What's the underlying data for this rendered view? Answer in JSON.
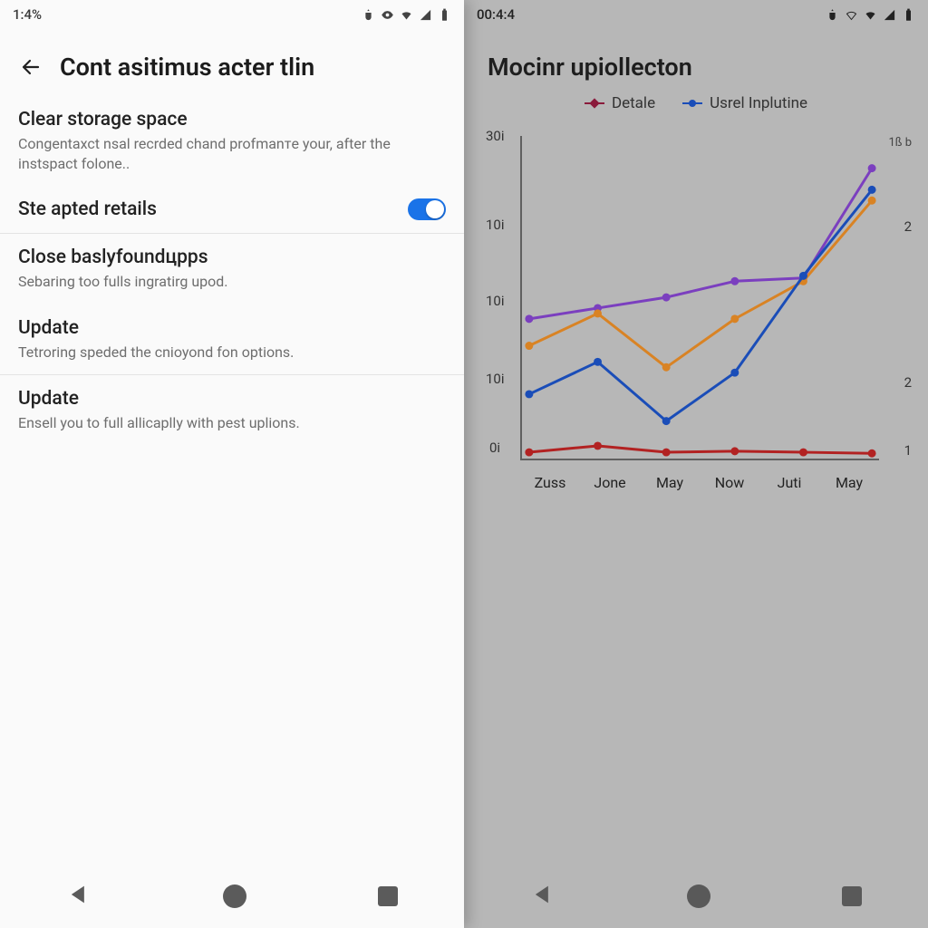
{
  "left": {
    "status_time": "1:4%",
    "title": "Cont asitimus acter tlin",
    "items": [
      {
        "title": "Clear storage space",
        "sub": "Congentaxct nsal recrded chand profmanтe your, after the instspact folone.."
      },
      {
        "title": "Ste apted retails",
        "toggle": true
      },
      {
        "title": "Close baslyfoundцpps",
        "sub": "Sebaring too fulls ingratirg upod."
      },
      {
        "title": "Update",
        "sub": "Tetroring speded the cnioyond fon options."
      },
      {
        "title": "Update",
        "sub": "Ensell you to full allicaplly with pest uplions."
      }
    ]
  },
  "right": {
    "status_time": "00:4:4",
    "title": "Mocinr upiollecton",
    "legend": [
      {
        "name": "Detale",
        "color": "#8a1a3b"
      },
      {
        "name": "Usrel Inplutine",
        "color": "#1a4db8"
      }
    ]
  },
  "yticks": {
    "0": "30i",
    "1": "10i",
    "2": "10i",
    "3": "10i",
    "4": "0i"
  },
  "right_axis": {
    "top": "1ß b",
    "r1": "2",
    "r2": "2",
    "r3": "1"
  },
  "chart_data": {
    "type": "line",
    "title": "Mocinr upiollecton",
    "xlabel": "",
    "ylabel": "",
    "ylim": [
      0,
      30
    ],
    "categories": [
      "Zuss",
      "Jone",
      "May",
      "Now",
      "Juti",
      "May"
    ],
    "series": [
      {
        "name": "purple",
        "color": "#7b3fbf",
        "values": [
          13,
          14,
          15,
          16.5,
          16.8,
          27
        ]
      },
      {
        "name": "orange",
        "color": "#d98324",
        "values": [
          10.5,
          13.5,
          8.5,
          13,
          16.5,
          24
        ]
      },
      {
        "name": "blue",
        "color": "#1a4db8",
        "values": [
          6,
          9,
          3.5,
          8,
          17,
          25
        ]
      },
      {
        "name": "red",
        "color": "#b22222",
        "values": [
          0.6,
          1.2,
          0.6,
          0.7,
          0.6,
          0.5
        ]
      }
    ]
  }
}
